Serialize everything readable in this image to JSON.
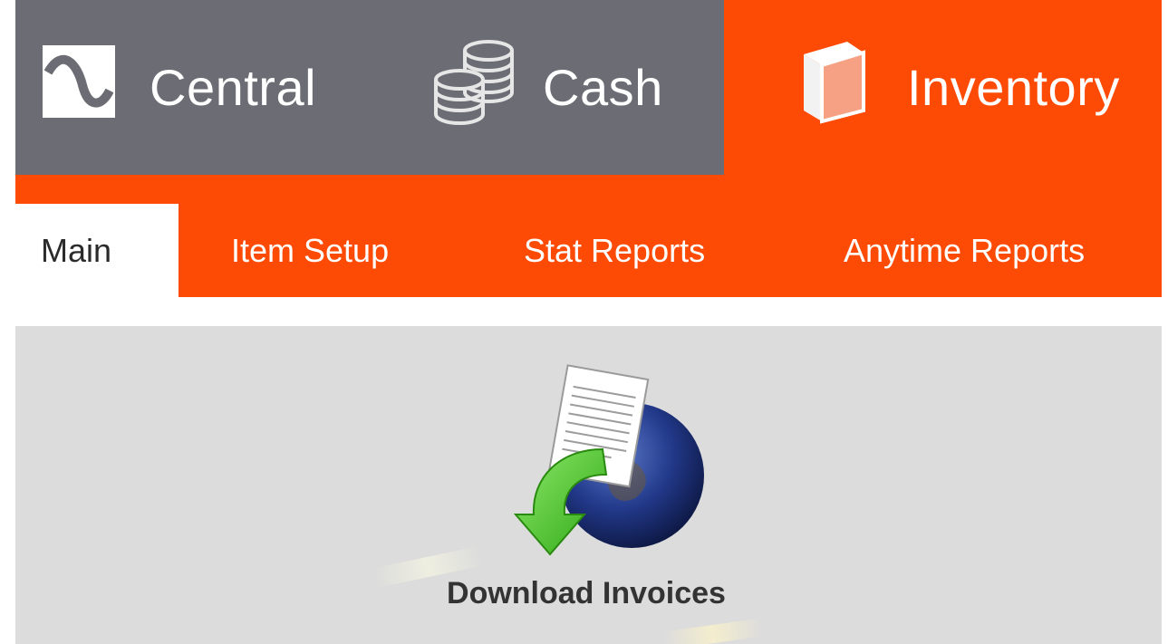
{
  "modules": [
    {
      "label": "Central",
      "icon": "central-wave-icon"
    },
    {
      "label": "Cash",
      "icon": "coins-icon"
    },
    {
      "label": "Inventory",
      "icon": "box-icon",
      "active": true
    }
  ],
  "tabs": [
    {
      "label": "Main",
      "active": true
    },
    {
      "label": "Item Setup"
    },
    {
      "label": "Stat Reports"
    },
    {
      "label": "Anytime Reports"
    }
  ],
  "content": {
    "tiles": [
      {
        "label": "Download Invoices",
        "icon": "download-invoices-icon"
      }
    ]
  },
  "colors": {
    "accent": "#fd4a04",
    "module_bar": "#6c6c74",
    "content_bg": "#dcdcdc",
    "tile_text": "#333333"
  }
}
